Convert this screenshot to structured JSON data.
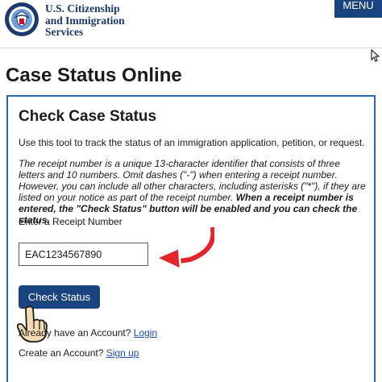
{
  "header": {
    "agency_line1": "U.S. Citizenship",
    "agency_line2": "and Immigration",
    "agency_line3": "Services",
    "menu_label": "MENU",
    "seal_icon": "dhs-seal-icon"
  },
  "page": {
    "title": "Case Status Online"
  },
  "card": {
    "title": "Check Case Status",
    "intro": "Use this tool to track the status of an immigration application, petition, or request.",
    "receipt_info_italic": "The receipt number is a unique 13-character identifier that consists of three letters and 10 numbers. Omit dashes (\"-\") when entering a receipt number. However, you can include all other characters, including asterisks (\"*\"), if they are listed on your notice as part of the receipt number. ",
    "receipt_info_bold": "When a receipt number is entered, the \"Check Status\" button will be enabled and you can check the status.",
    "input_label": "Enter a Receipt Number",
    "input_value": "EAC1234567890",
    "check_button": "Check Status",
    "already_text": "Already have an Account?",
    "login_link": "Login",
    "create_text": "Create an Account?",
    "signup_link": "Sign up"
  },
  "colors": {
    "brand_navy": "#1a4480",
    "card_border": "#2a67b0",
    "arrow_red": "#e3262b",
    "link_blue": "#1a4fb0"
  }
}
